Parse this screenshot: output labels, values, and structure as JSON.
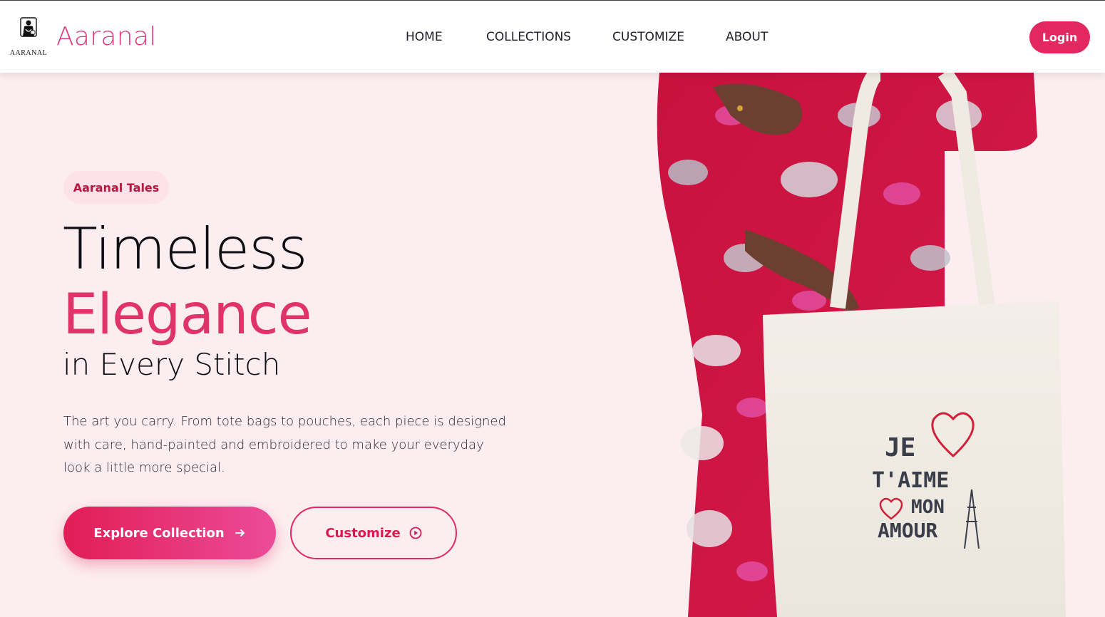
{
  "header": {
    "logo_text": "AARANAL",
    "brand": "Aaranal",
    "nav": [
      "HOME",
      "COLLECTIONS",
      "CUSTOMIZE",
      "ABOUT"
    ],
    "login_label": "Login"
  },
  "hero": {
    "tag": "Aaranal Tales",
    "title_line1": "Timeless",
    "title_line2": "Elegance",
    "title_line3": "in Every Stitch",
    "description": "The art you carry. From tote bags to pouches, each piece is designed with care, hand-painted and embroidered to make your everyday look a little more special.",
    "primary_button": "Explore Collection",
    "secondary_button": "Customize",
    "bag_print": {
      "line1": "JE",
      "line2": "T'AIME",
      "line3": "MON",
      "line4": "AMOUR"
    }
  },
  "colors": {
    "accent": "#e3275f",
    "brand": "#e0367a",
    "background": "#fcedf0"
  },
  "icons": {
    "primary_button_icon": "arrow-right-icon",
    "secondary_button_icon": "play-circle-icon"
  }
}
